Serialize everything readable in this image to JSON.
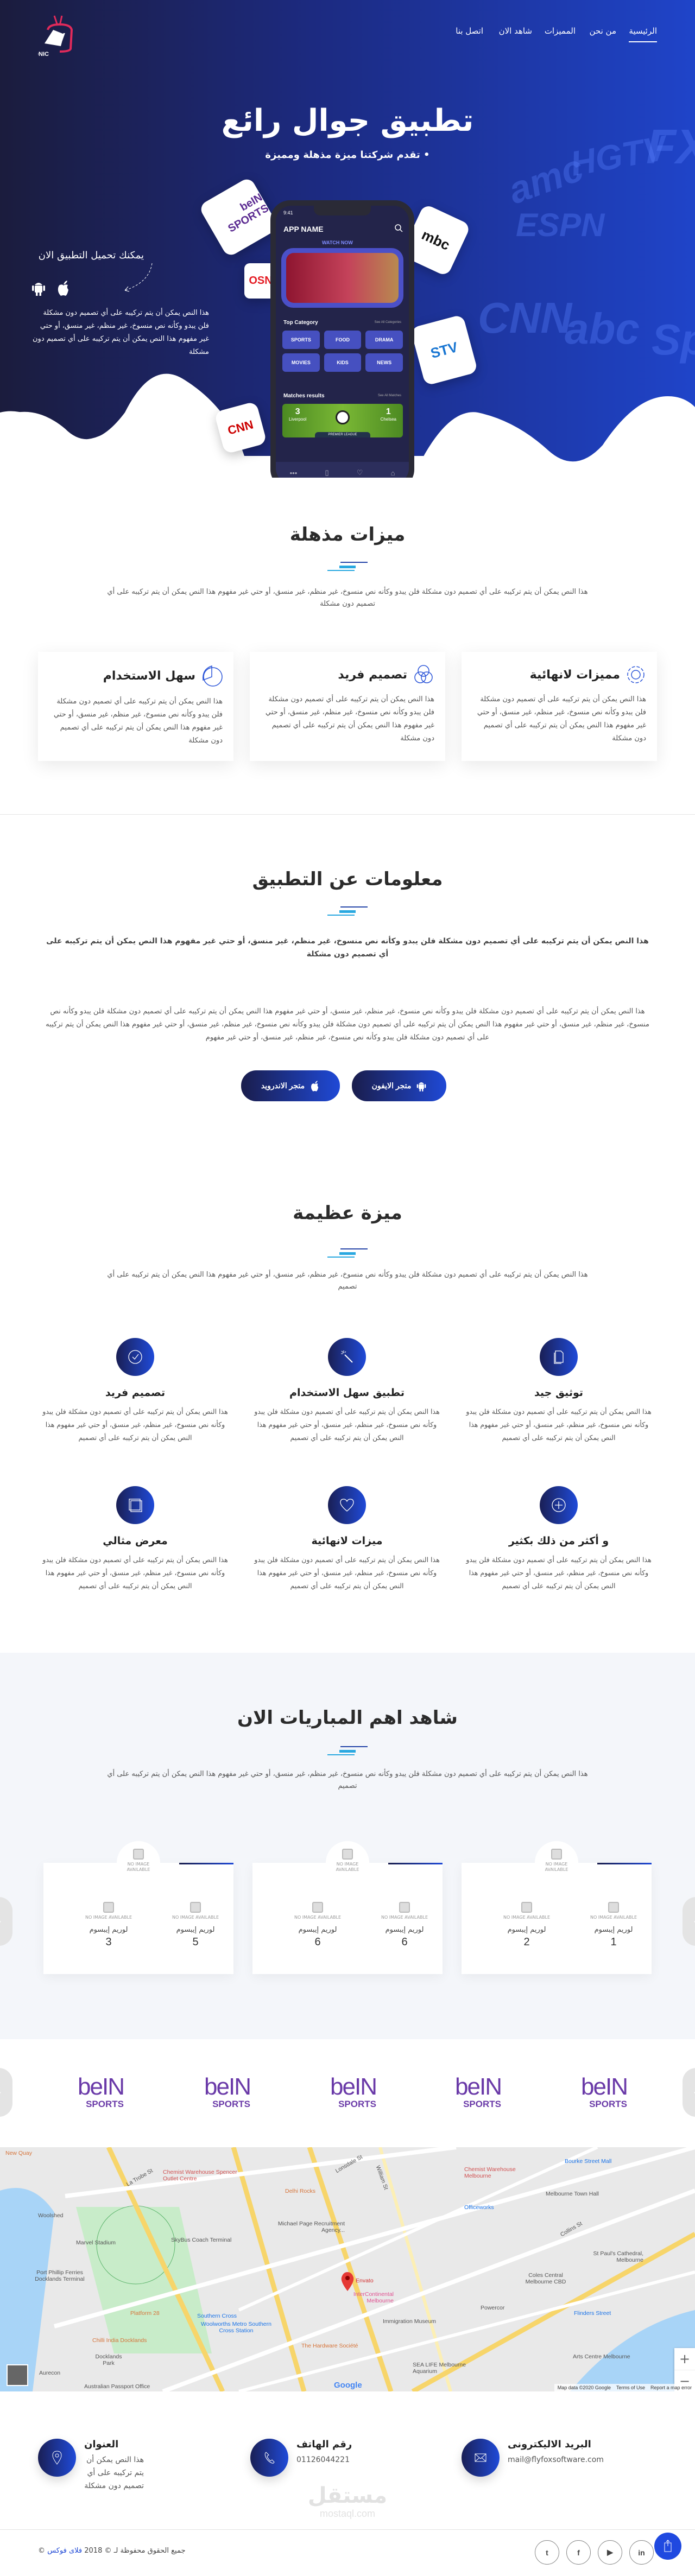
{
  "brand": {
    "logo_text": "SONIC TV",
    "primary": "#1f44c9",
    "dark": "#1b1c3d",
    "accent_light": "#29a8e0"
  },
  "nav": {
    "items": [
      {
        "label": "الرئيسية",
        "active": true
      },
      {
        "label": "من نحن"
      },
      {
        "label": "المميزات"
      },
      {
        "label": "شاهد الان"
      },
      {
        "label": "اتصل بنا"
      }
    ]
  },
  "hero": {
    "title": "تطبيق جوال رائع",
    "subtitle": "• تقدم شركتنا ميزة مذهلة ومميزة",
    "download_heading": "يمكنك تحميل التطبيق الان",
    "download_text": "هذا النص يمكن أن يتم تركيبه على أي تصميم دون مشكلة فلن يبدو وكأنه نص منسوخ، غير منظم، غير منسق، أو حتي غير مفهوم هذا النص يمكن أن يتم تركيبه على أي تصميم دون مشكلة",
    "channel_logos": [
      "beIN SPORTS",
      "OSN",
      "mbc",
      "STV",
      "CNN"
    ],
    "background_channels": [
      "amc",
      "HGTV",
      "FX",
      "ESPN",
      "CNN",
      "abc",
      "Sp"
    ],
    "phone": {
      "time": "9:41",
      "app_name": "APP NAME",
      "watch_now": "WATCH NOW",
      "top_category": "Top Category",
      "see_all_categories": "See All Categories",
      "categories": [
        "DRAMA",
        "FOOD",
        "SPORTS",
        "NEWS",
        "KIDS",
        "MOVIES"
      ],
      "matches_results": "Matches results",
      "see_all_matches": "See All Matches",
      "match": {
        "home": "Liverpool",
        "home_score": "3",
        "away": "Chelsea",
        "away_score": "1",
        "league": "PREMIER LEAGUE"
      }
    }
  },
  "features": {
    "title": "ميزات مذهلة",
    "intro": "هذا النص يمكن أن يتم تركيبه على أي تصميم دون مشكلة فلن يبدو وكأنه نص منسوخ، غير منظم، غير منسق، أو حتي غير مفهوم هذا النص يمكن أن يتم تركيبه على أي تصميم دون مشكلة",
    "cards": [
      {
        "title": "مميزات لانهائية",
        "icon": "gear-icon",
        "text": "هذا النص يمكن أن يتم تركيبه على أي تصميم دون مشكلة فلن يبدو وكأنه نص منسوخ، غير منظم، غير منسق، أو حتي غير مفهوم هذا النص يمكن أن يتم تركيبه على أي تصميم دون مشكلة"
      },
      {
        "title": "تصميم فريد",
        "icon": "circles-icon",
        "text": "هذا النص يمكن أن يتم تركيبه على أي تصميم دون مشكلة فلن يبدو وكأنه نص منسوخ، غير منظم، غير منسق، أو حتي غير مفهوم هذا النص يمكن أن يتم تركيبه على أي تصميم دون مشكلة"
      },
      {
        "title": "سهل الاستخدام",
        "icon": "pie-chart-icon",
        "text": "هذا النص يمكن أن يتم تركيبه على أي تصميم دون مشكلة فلن يبدو وكأنه نص منسوخ، غير منظم، غير منسق، أو حتي غير مفهوم هذا النص يمكن أن يتم تركيبه على أي تصميم دون مشكلة"
      }
    ]
  },
  "about": {
    "title": "معلومات عن التطبيق",
    "lead": "هذا النص يمكن أن يتم تركيبه على أي تصميم دون مشكلة فلن يبدو وكأنه نص منسوخ، غير منظم، غير منسق، أو حتي غير مفهوم هذا النص يمكن أن يتم تركيبه على أي تصميم دون مشكلة",
    "body": "هذا النص يمكن أن يتم تركيبه على أي تصميم دون مشكلة فلن يبدو وكأنه نص منسوخ، غير منظم، غير منسق، أو حتي غير مفهوم هذا النص يمكن أن يتم تركيبه على أي تصميم دون مشكلة فلن يبدو وكأنه نص منسوخ، غير منظم، غير منسق، أو حتي غير مفهوم هذا النص يمكن أن يتم تركيبه على أي تصميم دون مشكلة فلن يبدو وكأنه نص منسوخ، غير منظم، غير منسق، أو حتي غير مفهوم هذا النص يمكن أن يتم تركيبه على أي تصميم دون مشكلة فلن يبدو وكأنه نص منسوخ، غير منظم، غير منسق، أو حتي غير مفهوم",
    "iphone_store": "متجر الايفون",
    "android_store": "متجر الاندرويد"
  },
  "great": {
    "title": "ميزة عظيمة",
    "intro": "هذا النص يمكن أن يتم تركيبه على أي تصميم دون مشكلة فلن يبدو وكأنه نص منسوخ، غير منظم، غير منسق، أو حتي غير مفهوم هذا النص يمكن أن يتم تركيبه على أي تصميم",
    "items": [
      {
        "title": "توثيق جيد",
        "icon": "document-icon",
        "text": "هذا النص يمكن أن يتم تركيبه على أي تصميم دون مشكلة فلن يبدو وكأنه نص منسوخ، غير منظم، غير منسق، أو حتي غير مفهوم هذا النص يمكن أن يتم تركيبه على أي تصميم"
      },
      {
        "title": "تطبيق سهل الاستخدام",
        "icon": "magic-wand-icon",
        "text": "هذا النص يمكن أن يتم تركيبه على أي تصميم دون مشكلة فلن يبدو وكأنه نص منسوخ، غير منظم، غير منسق، أو حتي غير مفهوم هذا النص يمكن أن يتم تركيبه على أي تصميم"
      },
      {
        "title": "تصميم فريد",
        "icon": "check-circle-icon",
        "text": "هذا النص يمكن أن يتم تركيبه على أي تصميم دون مشكلة فلن يبدو وكأنه نص منسوخ، غير منظم، غير منسق، أو حتي غير مفهوم هذا النص يمكن أن يتم تركيبه على أي تصميم"
      },
      {
        "title": "و أكثر من ذلك بكثير",
        "icon": "plus-circle-icon",
        "text": "هذا النص يمكن أن يتم تركيبه على أي تصميم دون مشكلة فلن يبدو وكأنه نص منسوخ، غير منظم، غير منسق، أو حتي غير مفهوم هذا النص يمكن أن يتم تركيبه على أي تصميم"
      },
      {
        "title": "ميزات لانهائية",
        "icon": "heart-icon",
        "text": "هذا النص يمكن أن يتم تركيبه على أي تصميم دون مشكلة فلن يبدو وكأنه نص منسوخ، غير منظم، غير منسق، أو حتي غير مفهوم هذا النص يمكن أن يتم تركيبه على أي تصميم"
      },
      {
        "title": "معرض مثالي",
        "icon": "gallery-icon",
        "text": "هذا النص يمكن أن يتم تركيبه على أي تصميم دون مشكلة فلن يبدو وكأنه نص منسوخ، غير منظم، غير منسق، أو حتي غير مفهوم هذا النص يمكن أن يتم تركيبه على أي تصميم"
      }
    ]
  },
  "matches": {
    "title": "شاهد اهم المباريات الان",
    "intro": "هذا النص يمكن أن يتم تركيبه على أي تصميم دون مشكلة فلن يبدو وكأنه نص منسوخ، غير منظم، غير منسق، أو حتي غير مفهوم هذا النص يمكن أن يتم تركيبه على أي تصميم",
    "no_image": "NO IMAGE AVAILABLE",
    "cards": [
      {
        "teams": [
          {
            "name": "لوريم إيبسوم",
            "score": "1"
          },
          {
            "name": "لوريم إيبسوم",
            "score": "2"
          }
        ]
      },
      {
        "teams": [
          {
            "name": "لوريم إيبسوم",
            "score": "6"
          },
          {
            "name": "لوريم إيبسوم",
            "score": "6"
          }
        ]
      },
      {
        "teams": [
          {
            "name": "لوريم إيبسوم",
            "score": "5"
          },
          {
            "name": "لوريم إيبسوم",
            "score": "3"
          }
        ]
      }
    ]
  },
  "partners": {
    "logos": [
      "beIN SPORTS",
      "beIN SPORTS",
      "beIN SPORTS",
      "beIN SPORTS",
      "beIN SPORTS"
    ]
  },
  "map": {
    "labels": [
      "New Quay",
      "La Trobe St",
      "Chemist Warehouse Spencer Outlet Centre",
      "Lonsdale St",
      "William St",
      "Chemist Warehouse Melbourne",
      "Bourke Street Mall",
      "Delhi Rocks",
      "Melbourne Town Hall",
      "Officeworks",
      "Woolshed",
      "Marvel Stadium",
      "SkyBus Coach Terminal",
      "Michael Page Recruitment Agency...",
      "Collins St",
      "St Paul's Cathedral, Melbourne",
      "Envato",
      "Port Phillip Ferries Docklands Terminal",
      "Coles Central Melbourne CBD",
      "InterContinental Melbourne",
      "Powercor",
      "Platform 28",
      "Southern Cross",
      "Flinders Street",
      "Woolworths Metro Southern Cross Station",
      "Immigration Museum",
      "Chilli India Docklands",
      "The Hardware Société",
      "Arts Centre Melbourne",
      "Docklands Park",
      "SEA LIFE Melbourne Aquarium",
      "Aurecon",
      "Australian Passport Office"
    ],
    "attribution": "Map data ©2020 Google",
    "terms": "Terms of Use",
    "report": "Report a map error",
    "google": "Google",
    "zoom_in": "+",
    "zoom_out": "−"
  },
  "contact": {
    "email": {
      "title": "البريد الاليكترونى",
      "value": "mail@flyfoxsoftware.com"
    },
    "phone": {
      "title": "رقم الهاتف",
      "value": "01126044221"
    },
    "address": {
      "title": "العنوان",
      "value": "هذا النص يمكن أن يتم تركيبه على أي تصميم دون مشكلة"
    }
  },
  "watermark": {
    "arabic": "مستقل",
    "latin": "mostaql.com"
  },
  "footer": {
    "copyright_prefix": "جميع الحقوق محفوظة لـ © 2018",
    "company": "فلاى فوكس",
    "copyright_suffix": "©",
    "social": [
      "twitter",
      "facebook",
      "youtube",
      "linkedin"
    ]
  }
}
